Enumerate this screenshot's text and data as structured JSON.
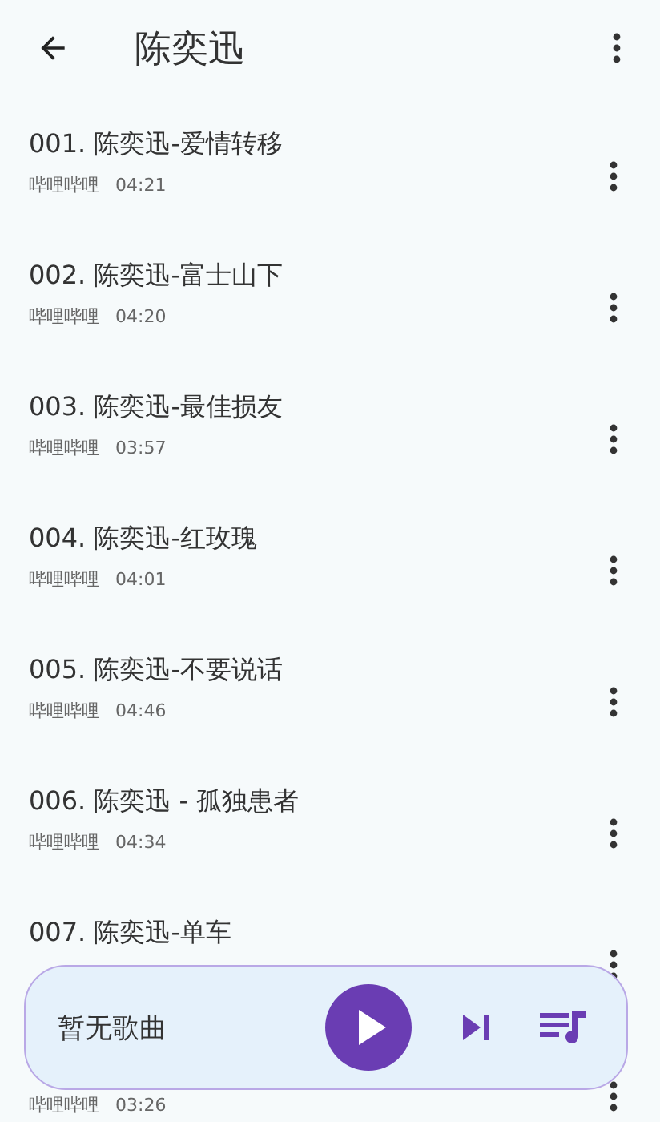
{
  "app_bar": {
    "title": "陈奕迅"
  },
  "songs": [
    {
      "title": "001. 陈奕迅-爱情转移",
      "source": "哔哩哔哩",
      "duration": "04:21"
    },
    {
      "title": "002. 陈奕迅-富士山下",
      "source": "哔哩哔哩",
      "duration": "04:20"
    },
    {
      "title": "003. 陈奕迅-最佳损友",
      "source": "哔哩哔哩",
      "duration": "03:57"
    },
    {
      "title": "004. 陈奕迅-红玫瑰",
      "source": "哔哩哔哩",
      "duration": "04:01"
    },
    {
      "title": "005. 陈奕迅-不要说话",
      "source": "哔哩哔哩",
      "duration": "04:46"
    },
    {
      "title": "006. 陈奕迅 - 孤独患者",
      "source": "哔哩哔哩",
      "duration": "04:34"
    },
    {
      "title": "007. 陈奕迅-单车"
    },
    {
      "source": "哔哩哔哩",
      "duration": "03:26"
    }
  ],
  "player": {
    "now_playing": "暂无歌曲"
  }
}
